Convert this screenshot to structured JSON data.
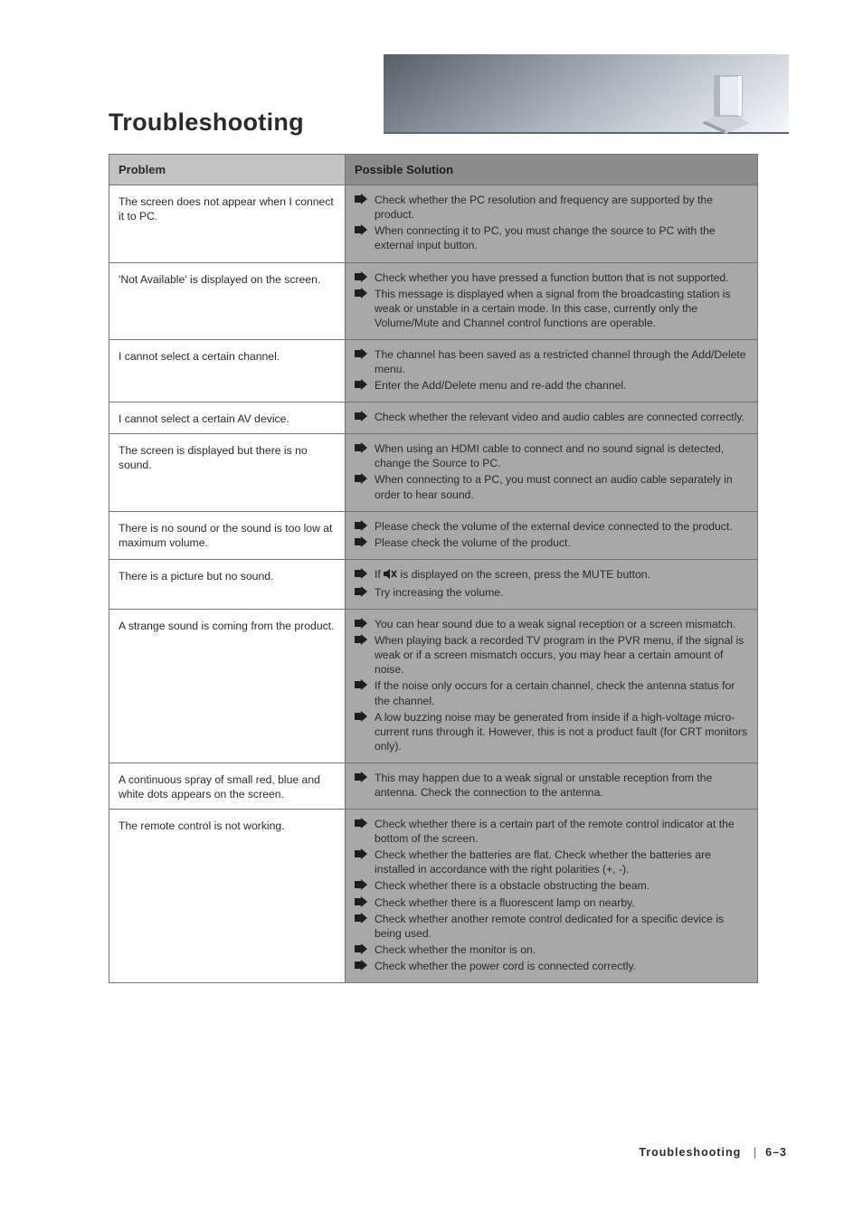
{
  "title": "Troubleshooting",
  "table": {
    "headers": {
      "problem": "Problem",
      "solution": "Possible Solution"
    },
    "rows": [
      {
        "problem": "The screen does not appear when I connect it to PC.",
        "solutions": [
          "Check whether the PC resolution and frequency are supported by the product.",
          "When connecting it to PC, you must change the source to PC with the external input button."
        ]
      },
      {
        "problem": "'Not Available' is displayed on the screen.",
        "solutions": [
          "Check whether you have pressed a function button that is not supported.",
          "This message is displayed when a signal from the broadcasting station is weak or unstable in a certain mode. In this case, currently only the Volume/Mute and Channel control functions are operable."
        ]
      },
      {
        "problem": "I cannot select a certain channel.",
        "solutions": [
          "The channel has been saved as a restricted channel through the Add/Delete menu.",
          "Enter the Add/Delete menu and re-add the channel."
        ]
      },
      {
        "problem": "I cannot select a certain AV device.",
        "solutions": [
          "Check whether the relevant video and audio cables are connected correctly."
        ]
      },
      {
        "problem": "The screen is displayed but there is no sound.",
        "solutions": [
          "When using an HDMI cable to connect and no sound signal is detected, change the Source to PC.",
          "When connecting to a PC, you must connect an audio cable separately in order to hear sound."
        ]
      },
      {
        "problem": "There is no sound or the sound is too low at maximum volume.",
        "solutions": [
          "Please check the volume of the external device connected to the product.",
          "Please check the volume of the product."
        ]
      },
      {
        "problem": "There is a picture but no sound.",
        "icon": "mute-icon",
        "solutions": [
          "If    is displayed on the screen, press the MUTE button.",
          "Try increasing the volume."
        ]
      },
      {
        "problem": "A strange sound is coming from the product.",
        "solutions": [
          "You can hear sound due to a weak signal reception or a screen mismatch.",
          "When playing back a recorded TV program in the PVR menu, if the signal is weak or if a screen mismatch occurs, you may hear a certain amount of noise.",
          "If the noise only occurs for a certain channel, check the antenna status for the channel.",
          "A low buzzing noise may be generated from inside if a high-voltage micro-current runs through it. However, this is not a product fault (for CRT monitors only)."
        ]
      },
      {
        "problem": "A continuous spray of small red, blue and white dots appears on the screen.",
        "solutions": [
          "This may happen due to a weak signal or unstable reception from the antenna. Check the connection to the antenna."
        ]
      },
      {
        "problem": "The remote control is not working.",
        "solutions": [
          "Check whether there is a certain part of the remote control indicator at the bottom of the screen.",
          "Check whether the batteries are flat. Check whether the batteries are installed in accordance with the right polarities (+, -).",
          "Check whether there is a obstacle obstructing the beam.",
          "Check whether there is a fluorescent lamp on nearby.",
          "Check whether another remote control dedicated for a specific device is being used.",
          "Check whether the monitor is on.",
          "Check whether the power cord is connected correctly."
        ]
      }
    ]
  },
  "page_label": "6–3",
  "icon_names": {
    "arrow": "arrow-right-icon",
    "mute": "mute-icon"
  }
}
